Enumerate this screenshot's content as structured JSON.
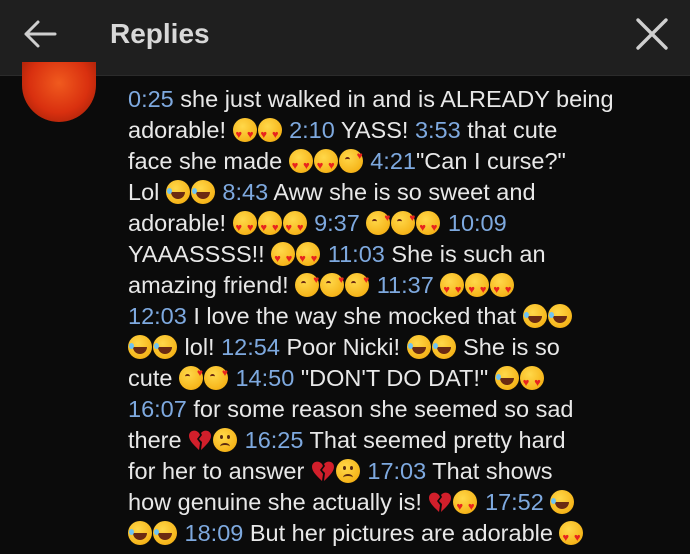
{
  "header": {
    "title": "Replies",
    "back_icon": "arrow-left-icon",
    "close_icon": "close-icon"
  },
  "comment": {
    "lines": [
      [
        {
          "t": "ts",
          "v": "0:25"
        },
        {
          "t": "text",
          "v": " she just walked in and is ALREADY being"
        }
      ],
      [
        {
          "t": "text",
          "v": "adorable! "
        },
        {
          "t": "emoji",
          "v": "heart-eyes"
        },
        {
          "t": "emoji",
          "v": "heart-eyes"
        },
        {
          "t": "text",
          "v": " "
        },
        {
          "t": "ts",
          "v": "2:10"
        },
        {
          "t": "text",
          "v": " YASS! "
        },
        {
          "t": "ts",
          "v": "3:53"
        },
        {
          "t": "text",
          "v": " that cute"
        }
      ],
      [
        {
          "t": "text",
          "v": "face she made "
        },
        {
          "t": "emoji",
          "v": "heart-eyes"
        },
        {
          "t": "emoji",
          "v": "heart-eyes"
        },
        {
          "t": "emoji",
          "v": "kiss"
        },
        {
          "t": "text",
          "v": " "
        },
        {
          "t": "ts",
          "v": "4:21"
        },
        {
          "t": "text",
          "v": "\"Can I curse?\""
        }
      ],
      [
        {
          "t": "text",
          "v": "Lol "
        },
        {
          "t": "emoji",
          "v": "laugh"
        },
        {
          "t": "emoji",
          "v": "laugh"
        },
        {
          "t": "text",
          "v": " "
        },
        {
          "t": "ts",
          "v": "8:43"
        },
        {
          "t": "text",
          "v": " Aww she is so sweet and"
        }
      ],
      [
        {
          "t": "text",
          "v": "adorable! "
        },
        {
          "t": "emoji",
          "v": "heart-eyes"
        },
        {
          "t": "emoji",
          "v": "heart-eyes"
        },
        {
          "t": "emoji",
          "v": "heart-eyes"
        },
        {
          "t": "text",
          "v": " "
        },
        {
          "t": "ts",
          "v": "9:37"
        },
        {
          "t": "text",
          "v": " "
        },
        {
          "t": "emoji",
          "v": "kiss"
        },
        {
          "t": "emoji",
          "v": "kiss"
        },
        {
          "t": "emoji",
          "v": "heart-eyes"
        },
        {
          "t": "text",
          "v": " "
        },
        {
          "t": "ts",
          "v": "10:09"
        }
      ],
      [
        {
          "t": "text",
          "v": "YAAASSSS!! "
        },
        {
          "t": "emoji",
          "v": "heart-eyes"
        },
        {
          "t": "emoji",
          "v": "heart-eyes"
        },
        {
          "t": "text",
          "v": " "
        },
        {
          "t": "ts",
          "v": "11:03"
        },
        {
          "t": "text",
          "v": " She is such an"
        }
      ],
      [
        {
          "t": "text",
          "v": "amazing friend! "
        },
        {
          "t": "emoji",
          "v": "kiss"
        },
        {
          "t": "emoji",
          "v": "kiss"
        },
        {
          "t": "emoji",
          "v": "kiss"
        },
        {
          "t": "text",
          "v": " "
        },
        {
          "t": "ts",
          "v": "11:37"
        },
        {
          "t": "text",
          "v": " "
        },
        {
          "t": "emoji",
          "v": "heart-eyes"
        },
        {
          "t": "emoji",
          "v": "heart-eyes"
        },
        {
          "t": "emoji",
          "v": "heart-eyes"
        }
      ],
      [
        {
          "t": "ts",
          "v": "12:03"
        },
        {
          "t": "text",
          "v": " I love the way she mocked that "
        },
        {
          "t": "emoji",
          "v": "laugh"
        },
        {
          "t": "emoji",
          "v": "laugh"
        }
      ],
      [
        {
          "t": "emoji",
          "v": "laugh"
        },
        {
          "t": "emoji",
          "v": "laugh"
        },
        {
          "t": "text",
          "v": " lol! "
        },
        {
          "t": "ts",
          "v": "12:54"
        },
        {
          "t": "text",
          "v": " Poor Nicki! "
        },
        {
          "t": "emoji",
          "v": "laugh"
        },
        {
          "t": "emoji",
          "v": "laugh"
        },
        {
          "t": "text",
          "v": " She is so"
        }
      ],
      [
        {
          "t": "text",
          "v": "cute "
        },
        {
          "t": "emoji",
          "v": "kiss"
        },
        {
          "t": "emoji",
          "v": "kiss"
        },
        {
          "t": "text",
          "v": " "
        },
        {
          "t": "ts",
          "v": "14:50"
        },
        {
          "t": "text",
          "v": " \"DON'T DO DAT!\" "
        },
        {
          "t": "emoji",
          "v": "laugh"
        },
        {
          "t": "emoji",
          "v": "heart-eyes"
        }
      ],
      [
        {
          "t": "ts",
          "v": "16:07"
        },
        {
          "t": "text",
          "v": " for some reason she seemed so sad"
        }
      ],
      [
        {
          "t": "text",
          "v": "there "
        },
        {
          "t": "emoji",
          "v": "broken-heart"
        },
        {
          "t": "emoji",
          "v": "frown"
        },
        {
          "t": "text",
          "v": " "
        },
        {
          "t": "ts",
          "v": "16:25"
        },
        {
          "t": "text",
          "v": " That seemed pretty hard"
        }
      ],
      [
        {
          "t": "text",
          "v": "for her to answer "
        },
        {
          "t": "emoji",
          "v": "broken-heart"
        },
        {
          "t": "emoji",
          "v": "frown"
        },
        {
          "t": "text",
          "v": " "
        },
        {
          "t": "ts",
          "v": "17:03"
        },
        {
          "t": "text",
          "v": " That shows"
        }
      ],
      [
        {
          "t": "text",
          "v": "how genuine she actually is! "
        },
        {
          "t": "emoji",
          "v": "broken-heart"
        },
        {
          "t": "emoji",
          "v": "heart-eyes"
        },
        {
          "t": "text",
          "v": " "
        },
        {
          "t": "ts",
          "v": "17:52"
        },
        {
          "t": "text",
          "v": " "
        },
        {
          "t": "emoji",
          "v": "laugh"
        }
      ],
      [
        {
          "t": "emoji",
          "v": "laugh"
        },
        {
          "t": "emoji",
          "v": "laugh"
        },
        {
          "t": "text",
          "v": " "
        },
        {
          "t": "ts",
          "v": "18:09"
        },
        {
          "t": "text",
          "v": " But her pictures are adorable "
        },
        {
          "t": "emoji",
          "v": "heart-eyes"
        }
      ]
    ]
  },
  "colors": {
    "header_bg": "#1f1f1f",
    "body_bg": "#0b0b0b",
    "timestamp": "#7ea9df",
    "text": "#e8e8e8"
  }
}
